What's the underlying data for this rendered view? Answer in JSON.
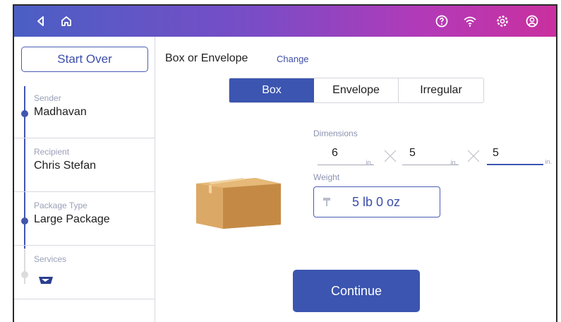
{
  "sidebar": {
    "start_over_label": "Start Over",
    "steps": [
      {
        "label": "Sender",
        "value": "Madhavan"
      },
      {
        "label": "Recipient",
        "value": "Chris Stefan"
      },
      {
        "label": "Package Type",
        "value": "Large Package"
      },
      {
        "label": "Services",
        "value": ""
      }
    ]
  },
  "main": {
    "type_label": "Box or Envelope",
    "change_label": "Change",
    "tabs": [
      {
        "label": "Box",
        "selected": true
      },
      {
        "label": "Envelope",
        "selected": false
      },
      {
        "label": "Irregular",
        "selected": false
      }
    ],
    "dimensions_label": "Dimensions",
    "dimensions": [
      {
        "value": "6",
        "unit": "in."
      },
      {
        "value": "5",
        "unit": "in."
      },
      {
        "value": "5",
        "unit": "in."
      }
    ],
    "weight_label": "Weight",
    "weight_value": "5 lb 0 oz",
    "continue_label": "Continue"
  },
  "icons": {
    "back": "back-arrow-icon",
    "home": "home-icon",
    "help": "help-icon",
    "wifi": "wifi-icon",
    "settings": "gear-icon",
    "account": "user-icon"
  },
  "colors": {
    "accent": "#3b55b0",
    "topbar_start": "#4a5fc4",
    "topbar_end": "#c9309f"
  }
}
